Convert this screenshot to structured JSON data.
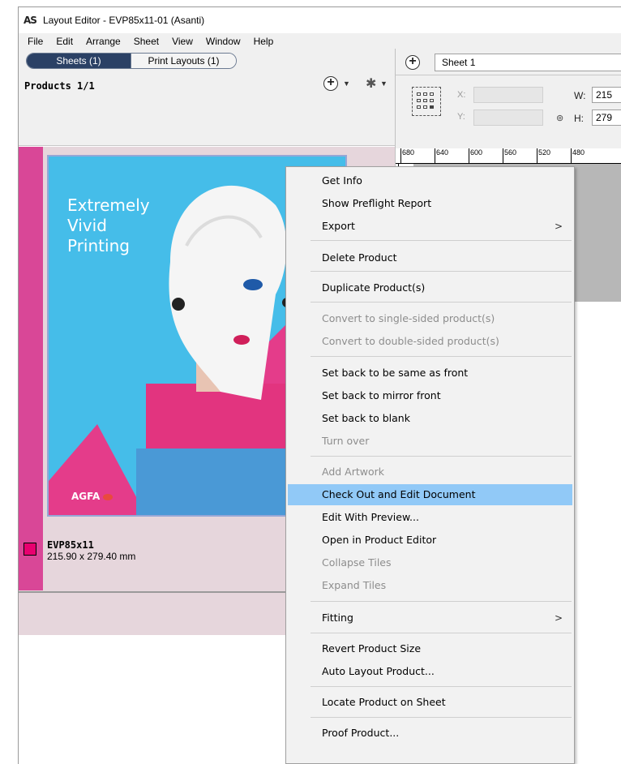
{
  "window": {
    "app_logo": "AS",
    "title": "Layout Editor - EVP85x11-01 (Asanti)"
  },
  "menubar": [
    "File",
    "Edit",
    "Arrange",
    "Sheet",
    "View",
    "Window",
    "Help"
  ],
  "left_panel": {
    "tabs": [
      {
        "label": "Sheets (1)",
        "active": true
      },
      {
        "label": "Print Layouts (1)",
        "active": false
      }
    ],
    "products_label": "Products 1/1",
    "icons": [
      "plus-circle-icon",
      "gear-icon"
    ],
    "product_card": {
      "artwork_headline": [
        "Extremely",
        "Vivid",
        "Printing"
      ],
      "artwork_logo": "AGFA",
      "name": "EVP85x11",
      "size": "215.90 x 279.40 mm",
      "swatch_color": "#e8006f"
    }
  },
  "right_panel": {
    "sheet_name": "Sheet 1",
    "x_label": "X:",
    "y_label": "Y:",
    "w_label": "W:",
    "h_label": "H:",
    "w_value": "215",
    "h_value": "279",
    "ruler_ticks": [
      "680",
      "640",
      "600",
      "560",
      "520",
      "480"
    ]
  },
  "context_menu": {
    "items": [
      {
        "label": "Get Info",
        "disabled": false
      },
      {
        "label": "Show Preflight Report",
        "disabled": false
      },
      {
        "label": "Export",
        "disabled": false,
        "submenu": true
      },
      {
        "label": "Delete Product",
        "disabled": false
      },
      {
        "label": "Duplicate Product(s)",
        "disabled": false
      },
      {
        "label": "Convert to single-sided product(s)",
        "disabled": true
      },
      {
        "label": "Convert to double-sided product(s)",
        "disabled": true
      },
      {
        "label": "Set back to be same as front",
        "disabled": false
      },
      {
        "label": "Set back to mirror front",
        "disabled": false
      },
      {
        "label": "Set back to blank",
        "disabled": false
      },
      {
        "label": "Turn over",
        "disabled": true
      },
      {
        "label": "Add Artwork",
        "disabled": true
      },
      {
        "label": "Check Out and Edit Document",
        "disabled": false,
        "highlighted": true
      },
      {
        "label": "Edit With Preview...",
        "disabled": false
      },
      {
        "label": "Open in Product Editor",
        "disabled": false
      },
      {
        "label": "Collapse Tiles",
        "disabled": true
      },
      {
        "label": "Expand Tiles",
        "disabled": true
      },
      {
        "label": "Fitting",
        "disabled": false,
        "submenu": true
      },
      {
        "label": "Revert Product Size",
        "disabled": false
      },
      {
        "label": "Auto Layout Product...",
        "disabled": false
      },
      {
        "label": "Locate Product on Sheet",
        "disabled": false
      },
      {
        "label": "Proof Product...",
        "disabled": false
      }
    ],
    "submenu_arrow": ">",
    "highlight_color": "#91c9f7"
  }
}
